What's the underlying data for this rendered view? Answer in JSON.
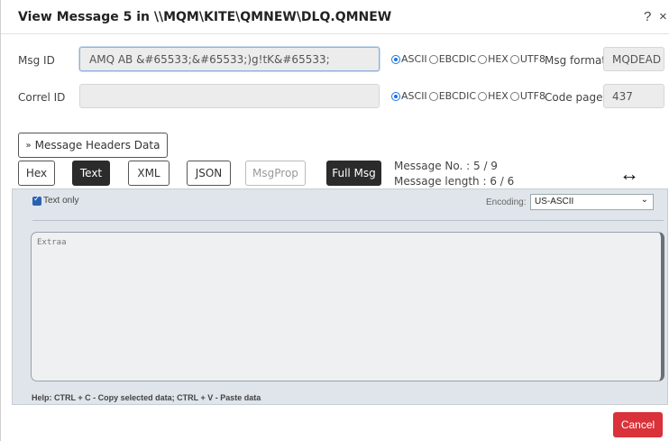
{
  "dialog": {
    "title": "View Message 5 in \\\\MQM\\KITE\\QMNEW\\DLQ.QMNEW",
    "help_glyph": "?",
    "close_glyph": "×"
  },
  "msg_id": {
    "label": "Msg ID",
    "value": "AMQ AB         &#65533;&#65533;)g!tK&#65533;",
    "encodings": [
      "ASCII",
      "EBCDIC",
      "HEX",
      "UTF8"
    ],
    "selected": "ASCII"
  },
  "correl_id": {
    "label": "Correl ID",
    "value": "",
    "encodings": [
      "ASCII",
      "EBCDIC",
      "HEX",
      "UTF8"
    ],
    "selected": "ASCII"
  },
  "msg_format": {
    "label": "Msg format",
    "value": "MQDEAD"
  },
  "code_page": {
    "label": "Code page",
    "value": "437"
  },
  "headers_toggle": {
    "icon": "chevrons-down-icon",
    "label": "Message Headers Data"
  },
  "view_buttons": [
    {
      "label": "Hex",
      "active": false
    },
    {
      "label": "Text",
      "active": true
    },
    {
      "label": "XML",
      "active": false
    },
    {
      "label": "JSON",
      "active": false
    },
    {
      "label": "MsgProp",
      "active": false,
      "disabled": true
    },
    {
      "label": "Full Msg",
      "active": true
    }
  ],
  "message_info": {
    "number": "Message No. : 5 / 9",
    "length": "Message length : 6 / 6"
  },
  "expand_icon": "↔",
  "panel": {
    "text_only_label": "Text only",
    "text_only_checked": true,
    "encoding_label": "Encoding:",
    "encoding_value": "US-ASCII",
    "content": "Extraa",
    "help": "Help: CTRL + C - Copy selected data; CTRL + V - Paste data"
  },
  "footer": {
    "cancel_label": "Cancel"
  },
  "colors": {
    "accent": "#1a73e8",
    "cancel": "#d9323a",
    "dark_button": "#2b2b2b",
    "panel_bg": "#dfe5ea"
  }
}
